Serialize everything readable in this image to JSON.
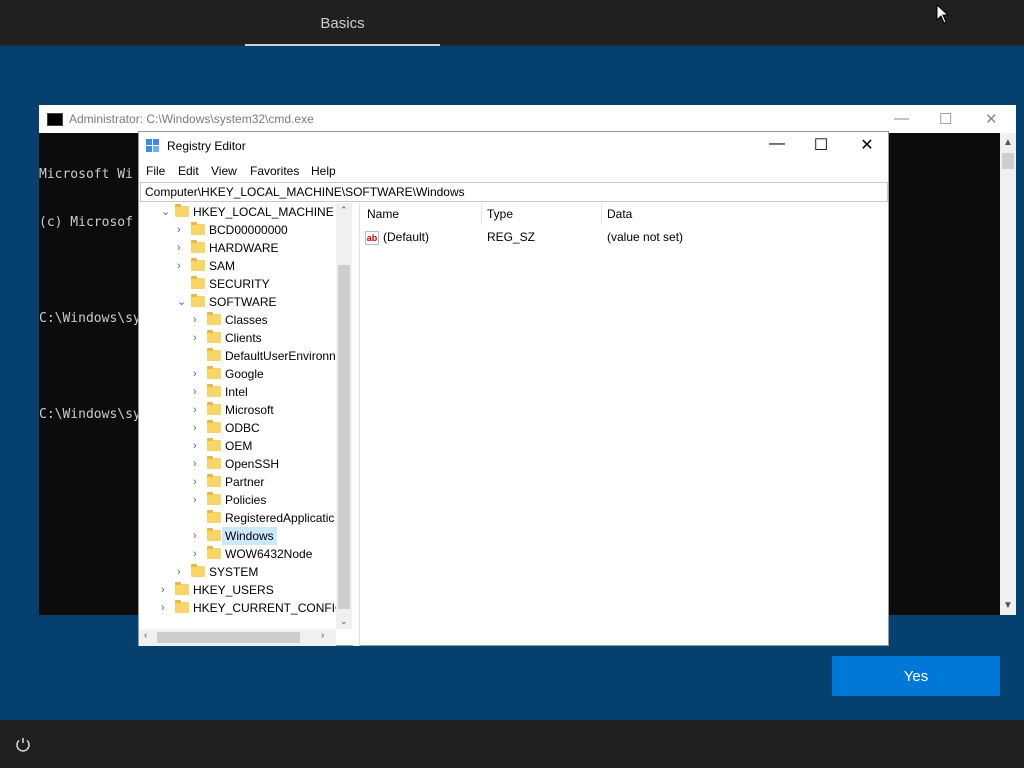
{
  "setup": {
    "tab_basics": "Basics",
    "yes_button": "Yes",
    "power_icon": "power-icon"
  },
  "cmd": {
    "title": "Administrator: C:\\Windows\\system32\\cmd.exe",
    "lines": [
      "Microsoft Wi",
      "(c) Microsof",
      "",
      "C:\\Windows\\sy",
      "",
      "C:\\Windows\\sy"
    ]
  },
  "regedit": {
    "title": "Registry Editor",
    "menu": [
      "File",
      "Edit",
      "View",
      "Favorites",
      "Help"
    ],
    "address": "Computer\\HKEY_LOCAL_MACHINE\\SOFTWARE\\Windows",
    "tree": [
      {
        "label": "HKEY_LOCAL_MACHINE",
        "level": 0,
        "expanded": true
      },
      {
        "label": "BCD00000000",
        "level": 1,
        "expander": true
      },
      {
        "label": "HARDWARE",
        "level": 1,
        "expander": true
      },
      {
        "label": "SAM",
        "level": 1,
        "expander": true
      },
      {
        "label": "SECURITY",
        "level": 1,
        "expander": false
      },
      {
        "label": "SOFTWARE",
        "level": 1,
        "expanded": true
      },
      {
        "label": "Classes",
        "level": 2,
        "expander": true
      },
      {
        "label": "Clients",
        "level": 2,
        "expander": true
      },
      {
        "label": "DefaultUserEnvironn",
        "level": 2,
        "expander": false
      },
      {
        "label": "Google",
        "level": 2,
        "expander": true
      },
      {
        "label": "Intel",
        "level": 2,
        "expander": true
      },
      {
        "label": "Microsoft",
        "level": 2,
        "expander": true
      },
      {
        "label": "ODBC",
        "level": 2,
        "expander": true
      },
      {
        "label": "OEM",
        "level": 2,
        "expander": true
      },
      {
        "label": "OpenSSH",
        "level": 2,
        "expander": true
      },
      {
        "label": "Partner",
        "level": 2,
        "expander": true
      },
      {
        "label": "Policies",
        "level": 2,
        "expander": true
      },
      {
        "label": "RegisteredApplicatic",
        "level": 2,
        "expander": false
      },
      {
        "label": "Windows",
        "level": 2,
        "expander": true,
        "selected": true
      },
      {
        "label": "WOW6432Node",
        "level": 2,
        "expander": true
      },
      {
        "label": "SYSTEM",
        "level": 1,
        "expander": true
      },
      {
        "label": "HKEY_USERS",
        "level": 0,
        "expander": true
      },
      {
        "label": "HKEY_CURRENT_CONFIG",
        "level": 0,
        "expander": true
      }
    ],
    "columns": [
      "Name",
      "Type",
      "Data"
    ],
    "values": [
      {
        "name": "(Default)",
        "type": "REG_SZ",
        "data": "(value not set)",
        "icon": "ab"
      }
    ]
  }
}
